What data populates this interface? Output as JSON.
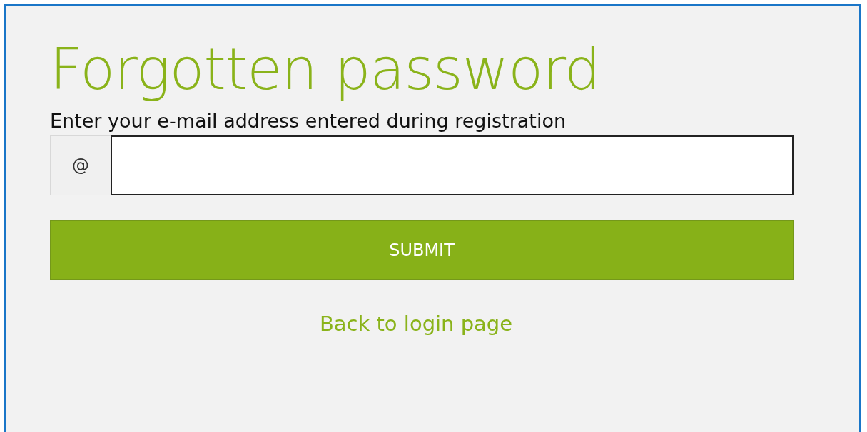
{
  "title": "Forgotten password",
  "email_field": {
    "label": "Enter your e-mail address entered during registration",
    "addon": "@"
  },
  "submit_button": {
    "label": "SUBMIT"
  },
  "back_link": {
    "label": "Back to login page"
  }
}
